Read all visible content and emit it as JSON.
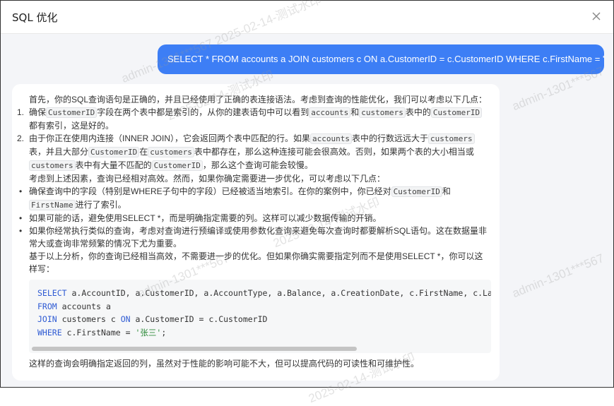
{
  "dialog": {
    "title": "SQL 优化"
  },
  "user_message": "SELECT * FROM accounts a JOIN customers c ON a.CustomerID = c.CustomerID WHERE c.FirstName = '张三';",
  "reply": {
    "intro": "首先，你的SQL查询语句是正确的，并且已经使用了正确的表连接语法。考虑到查询的性能优化，我们可以考虑以下几点：",
    "item1": {
      "num": "1.",
      "a": "确保",
      "c1": "CustomerID",
      "b": "字段在两个表中都是索引的，从你的建表语句中可以看到",
      "c2": "accounts",
      "c": "和",
      "c3": "customers",
      "d": "表中的",
      "c4": "CustomerID",
      "e": "都有索引，这是好的。"
    },
    "item2": {
      "num": "2.",
      "a": "由于你正在使用内连接（INNER JOIN），它会返回两个表中匹配的行。如果",
      "c1": "accounts",
      "b": "表中的行数远远大于",
      "c2": "customers",
      "c": "表，并且大部分",
      "c3": "CustomerID",
      "d": "在",
      "c4": "customers",
      "e": "表中都存在，那么这种连接可能会很高效。否则，如果两个表的大小相当或",
      "c5": "customers",
      "f": "表中有大量不匹配的",
      "c6": "CustomerID",
      "g": "，那么这个查询可能会较慢。"
    },
    "mid": "考虑到上述因素，查询已经相对高效。然而，如果你确定需要进一步优化，可以考虑以下几点：",
    "bullet1": {
      "a": "确保查询中的字段（特别是WHERE子句中的字段）已经被适当地索引。在你的案例中，你已经对",
      "c1": "CustomerID",
      "b": "和",
      "c2": "FirstName",
      "c": "进行了索引。"
    },
    "bullet2": "如果可能的话，避免使用SELECT *，而是明确指定需要的列。这样可以减少数据传输的开销。",
    "bullet3": "如果你经常执行类似的查询，考虑对查询进行预编译或使用参数化查询来避免每次查询时都要解析SQL语句。这在数据量非常大或查询非常频繁的情况下尤为重要。",
    "summary": "基于以上分析，你的查询已经相当高效，不需要进一步的优化。但如果你确实需要指定列而不是使用SELECT *，你可以这样写：",
    "code": {
      "l1_kw": "SELECT",
      "l1": " a.AccountID, a.CustomerID, a.AccountType, a.Balance, a.CreationDate, c.FirstName, c.LastN",
      "l2_kw": "FROM",
      "l2": " accounts a",
      "l3_kw": "JOIN",
      "l3": " customers c ",
      "l3_kw2": "ON",
      "l3b": " a.CustomerID = c.CustomerID",
      "l4_kw": "WHERE",
      "l4": " c.FirstName = ",
      "l4_str": "'张三'",
      "l4_end": ";"
    },
    "closing": "这样的查询会明确指定返回的列，虽然对于性能的影响可能不大，但可以提高代码的可读性和可维护性。"
  },
  "watermarks": [
    "admin-1301***567 2025-02-14-测试水印",
    "2025-02-14-测试水印",
    "admin-1301***567",
    "admin-1301***567",
    "admin-1301***567",
    "2025-02-14-测试水印",
    "2025-02-14-测试水印"
  ]
}
